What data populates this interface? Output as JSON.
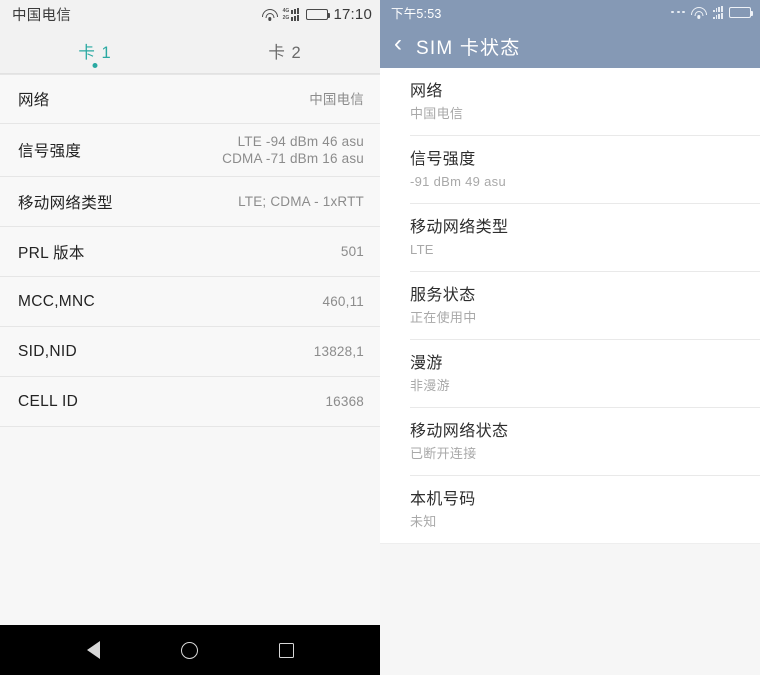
{
  "left_phone": {
    "status_bar": {
      "carrier": "中国电信",
      "clock": "17:10",
      "icons": [
        "wifi-icon",
        "dual-signal-icon",
        "battery-icon"
      ],
      "signal_labels": [
        "4G",
        "2G"
      ]
    },
    "tabs": [
      {
        "label": "卡 1",
        "active": true
      },
      {
        "label": "卡 2",
        "active": false
      }
    ],
    "accent_color": "#2aa9a2",
    "rows": [
      {
        "label": "网络",
        "value": "中国电信"
      },
      {
        "label": "信号强度",
        "value": "LTE -94 dBm  46 asu\nCDMA -71 dBm  16 asu"
      },
      {
        "label": "移动网络类型",
        "value": "LTE; CDMA - 1xRTT"
      },
      {
        "label": "PRL 版本",
        "value": "501"
      },
      {
        "label": "MCC,MNC",
        "value": "460,11"
      },
      {
        "label": "SID,NID",
        "value": "13828,1"
      },
      {
        "label": "CELL ID",
        "value": "16368"
      }
    ],
    "nav_bar": {
      "back": "back-triangle-icon",
      "home": "home-circle-icon",
      "recents": "recents-square-icon"
    }
  },
  "right_phone": {
    "status_bar": {
      "clock": "下午5:53",
      "icons": [
        "more-dots-icon",
        "wifi-icon",
        "dual-signal-icon",
        "battery-icon"
      ]
    },
    "app_bar": {
      "back_icon": "chevron-left-icon",
      "title": "SIM 卡状态",
      "background_color": "#8599b5"
    },
    "rows": [
      {
        "label": "网络",
        "sub": "中国电信"
      },
      {
        "label": "信号强度",
        "sub": "-91 dBm 49 asu"
      },
      {
        "label": "移动网络类型",
        "sub": "LTE"
      },
      {
        "label": "服务状态",
        "sub": "正在使用中"
      },
      {
        "label": "漫游",
        "sub": "非漫游"
      },
      {
        "label": "移动网络状态",
        "sub": "已断开连接"
      },
      {
        "label": "本机号码",
        "sub": "未知"
      }
    ]
  }
}
